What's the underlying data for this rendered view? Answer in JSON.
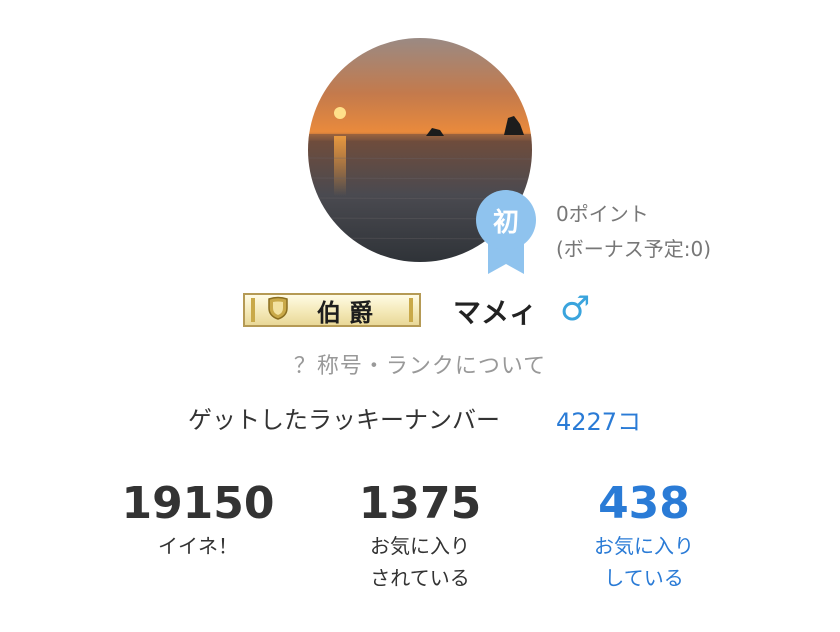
{
  "profile": {
    "avatar_alt": "sunset-over-sea-photo",
    "badge_label": "初",
    "points_text": "0ポイント",
    "bonus_text": "(ボーナス予定:0)",
    "rank_title": "伯爵",
    "username": "マメィ",
    "gender_icon": "♂",
    "rank_help_link": "？称号・ランクについて",
    "lucky_label": "ゲットしたラッキーナンバー",
    "lucky_count": "4227コ"
  },
  "stats": [
    {
      "value": "19150",
      "label_1": "イイネ！",
      "label_2": ""
    },
    {
      "value": "1375",
      "label_1": "お気に入り",
      "label_2": "されている"
    },
    {
      "value": "438",
      "label_1": "お気に入り",
      "label_2": "している"
    }
  ],
  "colors": {
    "accent_blue": "#2a7bd6",
    "badge_blue": "#8fc3ee",
    "male_blue": "#3aa4dd",
    "rank_gold": "#c9a949"
  }
}
